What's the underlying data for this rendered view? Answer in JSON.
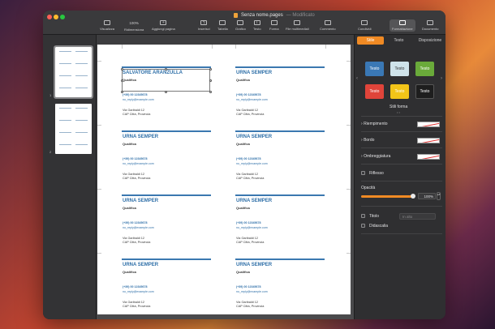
{
  "window": {
    "title": "Senza nome.pages",
    "status": "— Modificato",
    "traffic_colors": [
      "#ff5f57",
      "#febc2e",
      "#28c840"
    ]
  },
  "toolbar": {
    "buttons": [
      {
        "label": "Visualizza",
        "icon": "sidebar-icon"
      },
      {
        "label": "Ridimensiona",
        "icon": "zoom-icon",
        "value": "100%"
      },
      {
        "label": "Aggiungi pagina",
        "icon": "add-page-icon"
      },
      {
        "label": "Inserisci",
        "icon": "insert-icon"
      },
      {
        "label": "Tabella",
        "icon": "table-icon"
      },
      {
        "label": "Grafico",
        "icon": "chart-icon"
      },
      {
        "label": "Testo",
        "icon": "text-icon"
      },
      {
        "label": "Forma",
        "icon": "shape-icon"
      },
      {
        "label": "File multimediali",
        "icon": "media-icon"
      },
      {
        "label": "Commento",
        "icon": "comment-icon"
      },
      {
        "label": "Condividi",
        "icon": "share-icon"
      },
      {
        "label": "Formattazione",
        "icon": "brush-icon"
      },
      {
        "label": "Documento",
        "icon": "document-icon"
      }
    ]
  },
  "thumbnails": [
    {
      "number": "1"
    },
    {
      "number": "2"
    }
  ],
  "cards": [
    {
      "name": "SALVATORE ARANZULLA",
      "role": "Qualifica",
      "phone": "(+39) 00 12345678",
      "email": "no_reply@example.com",
      "address": "Via Garibaldi 12",
      "city": "CAP Città, Provincia"
    },
    {
      "name": "URNA SEMPER",
      "role": "Qualifica",
      "phone": "(+39) 00 12345678",
      "email": "no_reply@example.com",
      "address": "Via Garibaldi 12",
      "city": "CAP Città, Provincia"
    },
    {
      "name": "URNA SEMPER",
      "role": "Qualifica",
      "phone": "(+39) 00 12345678",
      "email": "no_reply@example.com",
      "address": "Via Garibaldi 12",
      "city": "CAP Città, Provincia"
    },
    {
      "name": "URNA SEMPER",
      "role": "Qualifica",
      "phone": "(+39) 00 12345678",
      "email": "no_reply@example.com",
      "address": "Via Garibaldi 12",
      "city": "CAP Città, Provincia"
    },
    {
      "name": "URNA SEMPER",
      "role": "Qualifica",
      "phone": "(+39) 00 12345678",
      "email": "no_reply@example.com",
      "address": "Via Garibaldi 12",
      "city": "CAP Città, Provincia"
    },
    {
      "name": "URNA SEMPER",
      "role": "Qualifica",
      "phone": "(+39) 00 12345678",
      "email": "no_reply@example.com",
      "address": "Via Garibaldi 12",
      "city": "CAP Città, Provincia"
    },
    {
      "name": "URNA SEMPER",
      "role": "Qualifica",
      "phone": "(+39) 00 12345678",
      "email": "no_reply@example.com",
      "address": "Via Garibaldi 12",
      "city": "CAP Città, Provincia"
    },
    {
      "name": "URNA SEMPER",
      "role": "Qualifica",
      "phone": "(+39) 00 12345678",
      "email": "no_reply@example.com",
      "address": "Via Garibaldi 12",
      "city": "CAP Città, Provincia"
    }
  ],
  "inspector": {
    "tabs": [
      "Stile",
      "Testo",
      "Disposizione"
    ],
    "styles": [
      {
        "label": "Testo",
        "color": "#3a78b5"
      },
      {
        "label": "Testo",
        "color": "#cfe3ea"
      },
      {
        "label": "Testo",
        "color": "#6aaa3a"
      },
      {
        "label": "Testo",
        "color": "#e0443a"
      },
      {
        "label": "Testo",
        "color": "#f2c418"
      },
      {
        "label": "Testo",
        "color": "#1e1e1e"
      }
    ],
    "styles_label": "Stili forma",
    "fill_label": "Riempimento",
    "border_label": "Bordo",
    "shadow_label": "Ombreggiatura",
    "reflection_label": "Riflesso",
    "opacity_label": "Opacità",
    "opacity_value": "100%",
    "opacity_level": 1.0,
    "title_label": "Titolo",
    "title_position": "In alto",
    "caption_label": "Didascalia",
    "accent_color": "#f08a24"
  }
}
